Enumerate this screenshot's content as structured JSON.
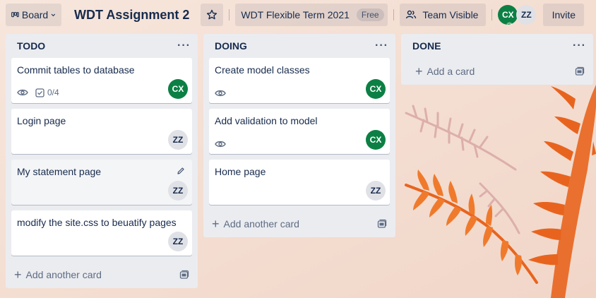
{
  "header": {
    "board_label": "Board",
    "title": "WDT Assignment 2",
    "workspace_label": "WDT Flexible Term 2021",
    "plan_badge": "Free",
    "visibility_label": "Team Visible",
    "members": [
      "CX",
      "ZZ"
    ],
    "invite_label": "Invite"
  },
  "lists": [
    {
      "title": "TODO",
      "menu": "···",
      "add_label": "Add another card",
      "cards": [
        {
          "title": "Commit tables to database",
          "checklist": "0/4",
          "member": "CX"
        },
        {
          "title": "Login page",
          "member": "ZZ"
        },
        {
          "title": "My statement page",
          "member": "ZZ"
        },
        {
          "title": "modify the site.css to beuatify pages",
          "member": "ZZ"
        }
      ]
    },
    {
      "title": "DOING",
      "menu": "···",
      "add_label": "Add another card",
      "cards": [
        {
          "title": "Create model classes",
          "member": "CX"
        },
        {
          "title": "Add validation to model",
          "member": "CX"
        },
        {
          "title": "Home page",
          "member": "ZZ"
        }
      ]
    },
    {
      "title": "DONE",
      "menu": "···",
      "add_label": "Add a card",
      "cards": []
    }
  ],
  "colors": {
    "member_cx": "#0c8044",
    "member_zz": "#dfe1e6",
    "list_bg": "#ebecf0",
    "background": "#f6e1d5"
  }
}
